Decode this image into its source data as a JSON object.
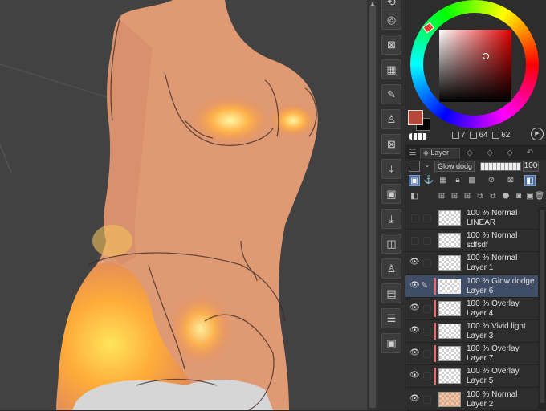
{
  "canvas": {
    "description_icon": "artwork-canvas"
  },
  "toolbar_icons": [
    "rotate-icon",
    "zoom-reset-icon",
    "close-layer-icon",
    "select-layer-icon",
    "edit-icon",
    "mannequin-icon",
    "close-icon",
    "import-icon",
    "frame-icon",
    "export-icon",
    "image-icon",
    "figure-icon",
    "page-icon",
    "stack-icon",
    "frame2-icon"
  ],
  "color": {
    "main": "#b3493a",
    "sub": "#050505",
    "h_value": "7",
    "s_value": "64",
    "v_value": "62"
  },
  "layer_panel": {
    "tab_label": "Layer",
    "blend_mode": "Glow dodg",
    "opacity": "100",
    "layers": [
      {
        "mode": "100 % Normal",
        "name": "LINEAR",
        "visible": false,
        "selected": false,
        "clip": false,
        "thumb": "plain"
      },
      {
        "mode": "100 % Normal",
        "name": "sdfsdf",
        "visible": false,
        "selected": false,
        "clip": false,
        "thumb": "plain"
      },
      {
        "mode": "100 % Normal",
        "name": "Layer 1",
        "visible": true,
        "selected": false,
        "clip": false,
        "thumb": "plain"
      },
      {
        "mode": "100 % Glow dodge",
        "name": "Layer 6",
        "visible": true,
        "selected": true,
        "clip": true,
        "thumb": "plain"
      },
      {
        "mode": "100 % Overlay",
        "name": "Layer 4",
        "visible": true,
        "selected": false,
        "clip": true,
        "thumb": "plain"
      },
      {
        "mode": "100 % Vivid light",
        "name": "Layer 3",
        "visible": true,
        "selected": false,
        "clip": true,
        "thumb": "plain"
      },
      {
        "mode": "100 % Overlay",
        "name": "Layer 7",
        "visible": true,
        "selected": false,
        "clip": true,
        "thumb": "plain"
      },
      {
        "mode": "100 % Overlay",
        "name": "Layer 5",
        "visible": true,
        "selected": false,
        "clip": true,
        "thumb": "plain"
      },
      {
        "mode": "100 % Normal",
        "name": "Layer 2",
        "visible": true,
        "selected": false,
        "clip": false,
        "thumb": "orange"
      }
    ]
  }
}
